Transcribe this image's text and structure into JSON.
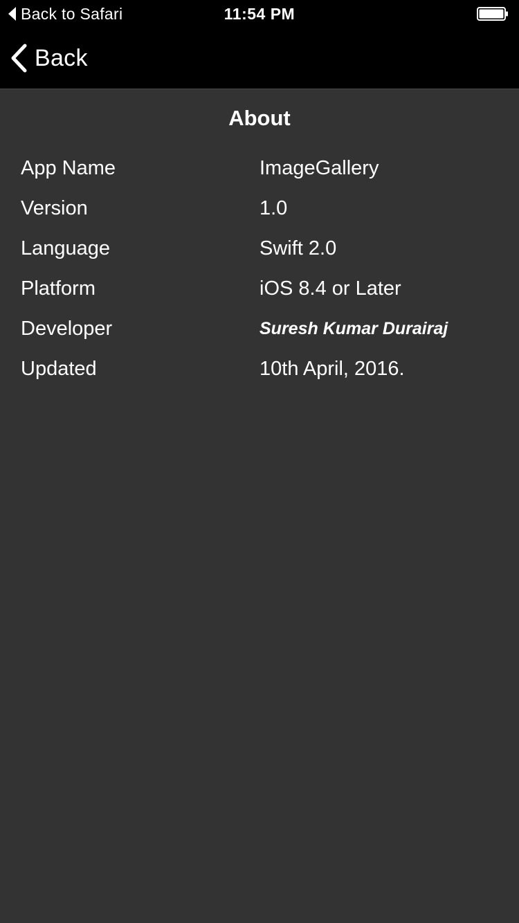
{
  "status_bar": {
    "back_label": "Back to Safari",
    "time": "11:54 PM"
  },
  "nav": {
    "back_label": "Back"
  },
  "page": {
    "title": "About"
  },
  "info": [
    {
      "label": "App Name",
      "value": "ImageGallery"
    },
    {
      "label": "Version",
      "value": "1.0"
    },
    {
      "label": "Language",
      "value": "Swift 2.0"
    },
    {
      "label": "Platform",
      "value": "iOS 8.4 or Later"
    },
    {
      "label": "Developer",
      "value": "Suresh Kumar Durairaj"
    },
    {
      "label": "Updated",
      "value": "10th April, 2016."
    }
  ],
  "colors": {
    "background": "#333333",
    "bars": "#000000",
    "text": "#ffffff"
  },
  "icons": {
    "status_back": "back-triangle-icon",
    "nav_back": "chevron-left-icon",
    "battery": "battery-icon"
  }
}
